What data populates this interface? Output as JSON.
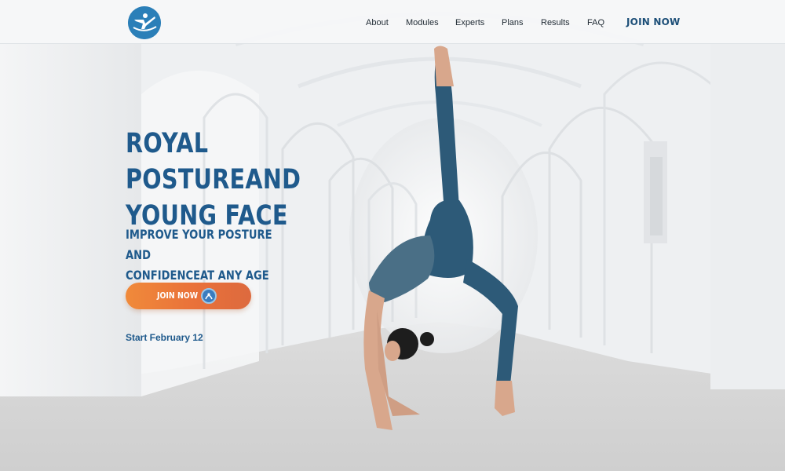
{
  "nav": {
    "items": [
      {
        "label": "About"
      },
      {
        "label": "Modules"
      },
      {
        "label": "Experts"
      },
      {
        "label": "Plans"
      },
      {
        "label": "Results"
      },
      {
        "label": "FAQ"
      }
    ],
    "join_label": "JOIN NOW"
  },
  "hero": {
    "headline_line1": "ROYAL POSTUREAND",
    "headline_line2": "YOUNG FACE",
    "sub_line1": "IMPROVE YOUR POSTURE AND",
    "sub_line2": "CONFIDENCEAT ANY AGE",
    "cta_label": "JOIN NOW",
    "start_text": "Start February 12"
  },
  "colors": {
    "brand_blue": "#1f5a8c",
    "cta_orange": "#ec7a3a",
    "logo_blue": "#2b7fb8"
  },
  "icons": {
    "logo": "gymnast-logo-icon",
    "cta_badge": "brand-badge-icon"
  }
}
